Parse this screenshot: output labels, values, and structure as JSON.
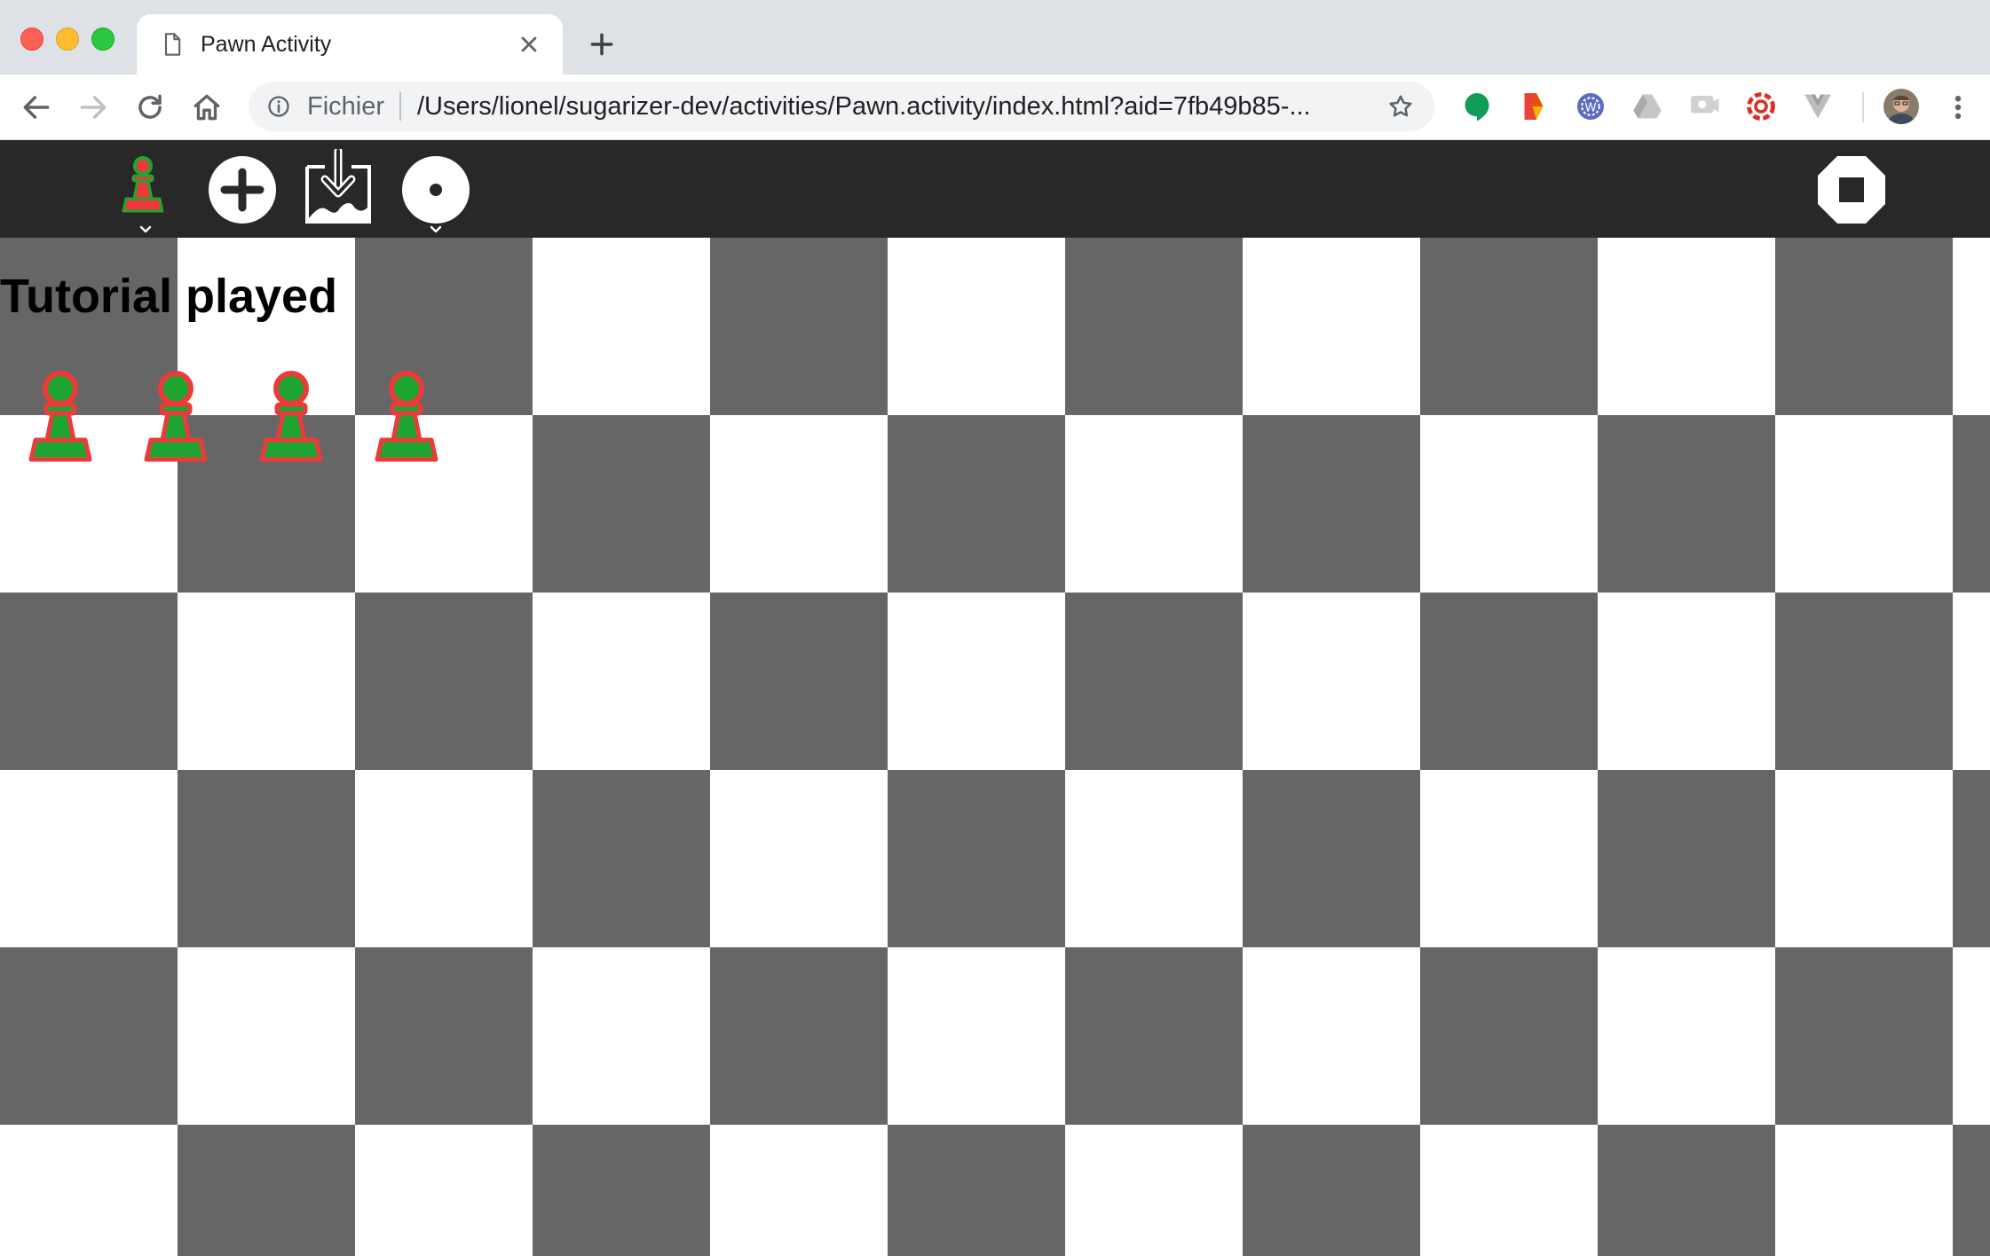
{
  "browser": {
    "tab": {
      "title": "Pawn Activity",
      "icon": "page-icon"
    },
    "omnibox": {
      "scheme_label": "Fichier",
      "url": "/Users/lionel/sugarizer-dev/activities/Pawn.activity/index.html?aid=7fb49b85-..."
    },
    "extensions": [
      "hangouts-icon",
      "extension-icon-orange",
      "wordsearch-icon",
      "drive-icon",
      "cast-icon",
      "extension-icon-red",
      "vue-devtools-icon"
    ],
    "colors": {
      "tabstrip": "#dee1e6",
      "toolbar": "#ffffff",
      "omnibox": "#f1f3f4"
    }
  },
  "activity_toolbar": {
    "buttons": [
      {
        "name": "activity-button",
        "icon": "pawn-icon"
      },
      {
        "name": "add-pawn-button",
        "icon": "plus-icon"
      },
      {
        "name": "insert-image-button",
        "icon": "insert-image-icon"
      },
      {
        "name": "network-button",
        "icon": "network-icon"
      },
      {
        "name": "stop-button",
        "icon": "stop-icon"
      }
    ],
    "colors": {
      "background": "#282828",
      "icon": "#ffffff"
    }
  },
  "board": {
    "status_text": "Tutorial played",
    "pawn_count": 4,
    "colors": {
      "dark_square": "#666666",
      "light_square": "#ffffff",
      "pawn_fill": "#1ea532",
      "pawn_stroke": "#ec3a3a"
    }
  }
}
